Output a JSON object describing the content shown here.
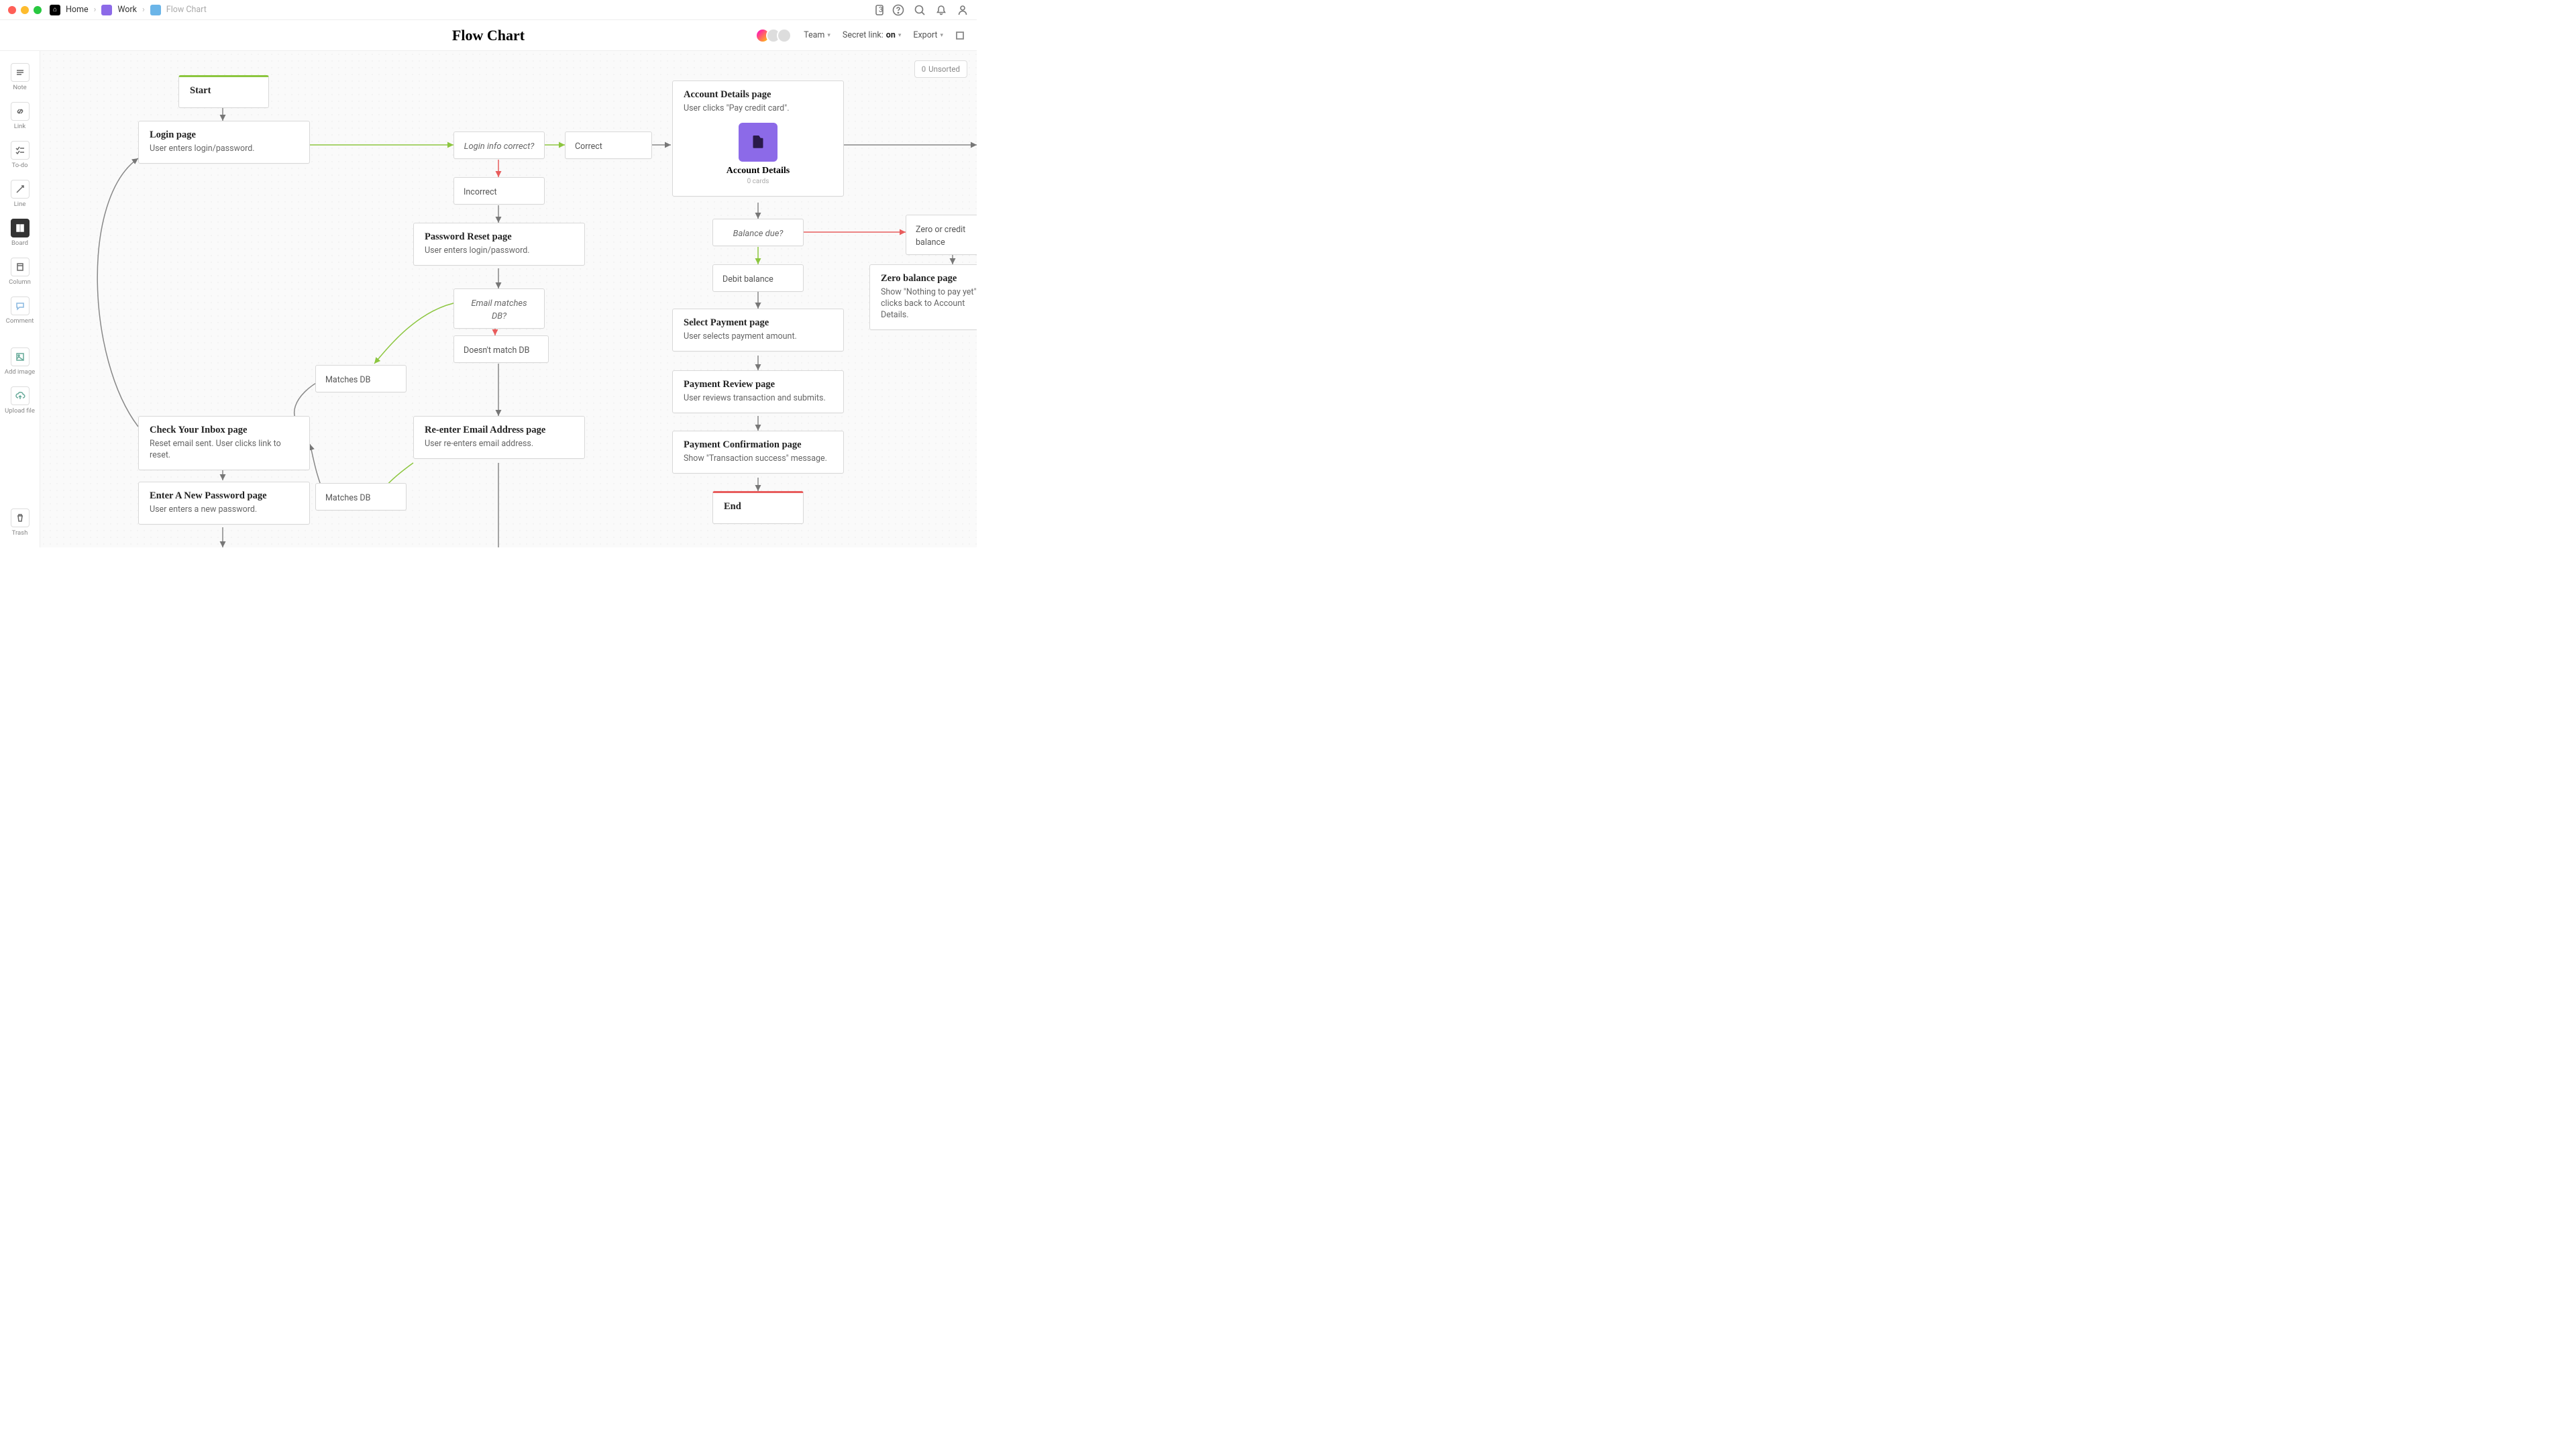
{
  "breadcrumb": {
    "home": "Home",
    "work": "Work",
    "flow": "Flow Chart"
  },
  "titlebar": {
    "devices": "3"
  },
  "header": {
    "title": "Flow Chart",
    "team": "Team",
    "secret_prefix": "Secret link: ",
    "secret_state": "on",
    "export": "Export"
  },
  "tools": {
    "note": "Note",
    "link": "Link",
    "todo": "To-do",
    "line": "Line",
    "board": "Board",
    "column": "Column",
    "comment": "Comment",
    "add_image": "Add image",
    "upload": "Upload file",
    "trash": "Trash"
  },
  "unsorted": {
    "count": "0",
    "label": "Unsorted"
  },
  "nodes": {
    "start": "Start",
    "login_t": "Login page",
    "login_b": "User enters login/password.",
    "login_q": "Login info correct?",
    "correct": "Correct",
    "incorrect": "Incorrect",
    "pwreset_t": "Password Reset page",
    "pwreset_b": "User enters login/password.",
    "email_q": "Email matches DB?",
    "no_match": "Doesn't match DB",
    "matches1": "Matches DB",
    "matches2": "Matches DB",
    "inbox_t": "Check Your Inbox page",
    "inbox_b": "Reset email sent. User clicks link to reset.",
    "reenter_t": "Re-enter Email Address page",
    "reenter_b": "User re-enters email address.",
    "newpw_t": "Enter A New Password page",
    "newpw_b": "User enters a new password.",
    "acct_t": "Account Details page",
    "acct_b": "User clicks \"Pay credit card\".",
    "acct_card": "Account Details",
    "acct_cards": "0 cards",
    "balance_q": "Balance due?",
    "debit": "Debit balance",
    "zero_credit": "Zero or credit balance",
    "select_t": "Select Payment page",
    "select_b": "User selects payment amount.",
    "review_t": "Payment Review page",
    "review_b": "User reviews transaction and submits.",
    "confirm_t": "Payment Confirmation page",
    "confirm_b": "Show \"Transaction success\" message.",
    "zerobal_t": "Zero balance page",
    "zerobal_b": "Show \"Nothing to pay yet\" me clicks back to Account Details.",
    "end": "End"
  }
}
